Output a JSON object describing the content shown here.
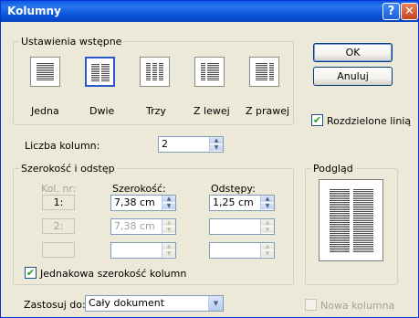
{
  "window": {
    "title": "Kolumny"
  },
  "titlebar": {
    "help_glyph": "?",
    "close_glyph": "✕"
  },
  "presets": {
    "label": "Ustawienia wstępne",
    "items": [
      {
        "label": "Jedna",
        "columns": 1
      },
      {
        "label": "Dwie",
        "columns": 2,
        "selected": true
      },
      {
        "label": "Trzy",
        "columns": 3
      },
      {
        "label": "Z lewej",
        "columns": 2
      },
      {
        "label": "Z prawej",
        "columns": 2
      }
    ]
  },
  "buttons": {
    "ok": "OK",
    "cancel": "Anuluj"
  },
  "line_between": {
    "label": "Rozdzielone linią",
    "checked": true
  },
  "column_count": {
    "label": "Liczba kolumn:",
    "value": "2"
  },
  "width_spacing": {
    "label": "Szerokość i odstęp",
    "headers": {
      "col": "Kol. nr:",
      "width": "Szerokość:",
      "spacing": "Odstępy:"
    },
    "rows": [
      {
        "num": "1:",
        "width": "7,38 cm",
        "spacing": "1,25 cm",
        "enabled": true
      },
      {
        "num": "2:",
        "width": "7,38 cm",
        "spacing": "",
        "enabled": false
      },
      {
        "num": "",
        "width": "",
        "spacing": "",
        "enabled": false
      }
    ],
    "equal_width": {
      "label": "Jednakowa szerokość kolumn",
      "checked": true
    }
  },
  "preview": {
    "label": "Podgląd"
  },
  "apply_to": {
    "label": "Zastosuj do:",
    "value": "Cały dokument"
  },
  "new_column": {
    "label": "Nowa kolumna",
    "checked": false
  },
  "glyphs": {
    "check": "✔",
    "up": "▲",
    "down": "▼",
    "dropdown": "▼"
  }
}
